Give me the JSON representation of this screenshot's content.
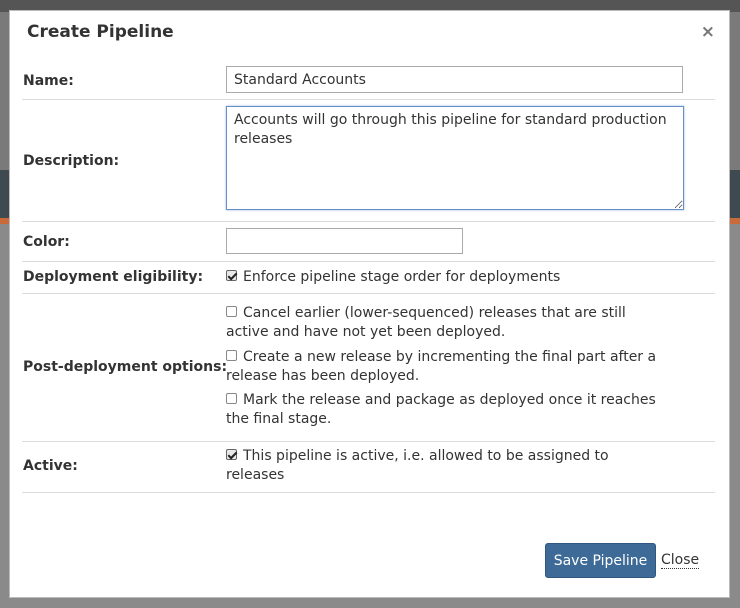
{
  "dialog": {
    "title": "Create Pipeline",
    "close_icon": "×"
  },
  "form": {
    "name": {
      "label": "Name:",
      "value": "Standard Accounts"
    },
    "description": {
      "label": "Description:",
      "value": "Accounts will go through this pipeline for standard production releases"
    },
    "color": {
      "label": "Color:",
      "value": ""
    },
    "deployment_eligibility": {
      "label": "Deployment eligibility:",
      "options": [
        {
          "text": "Enforce pipeline stage order for deployments",
          "checked": true
        }
      ]
    },
    "post_deployment": {
      "label": "Post-deployment options:",
      "options": [
        {
          "text": "Cancel earlier (lower-sequenced) releases that are still active and have not yet been deployed.",
          "checked": false
        },
        {
          "text": "Create a new release by incrementing the final part after a release has been deployed.",
          "checked": false
        },
        {
          "text": "Mark the release and package as deployed once it reaches the final stage.",
          "checked": false
        }
      ]
    },
    "active": {
      "label": "Active:",
      "options": [
        {
          "text": "This pipeline is active, i.e. allowed to be assigned to releases",
          "checked": true
        }
      ]
    }
  },
  "footer": {
    "save_label": "Save Pipeline",
    "close_label": "Close"
  },
  "colors": {
    "primary_button": "#3d6a96",
    "focus_border": "#6a8fc7"
  }
}
